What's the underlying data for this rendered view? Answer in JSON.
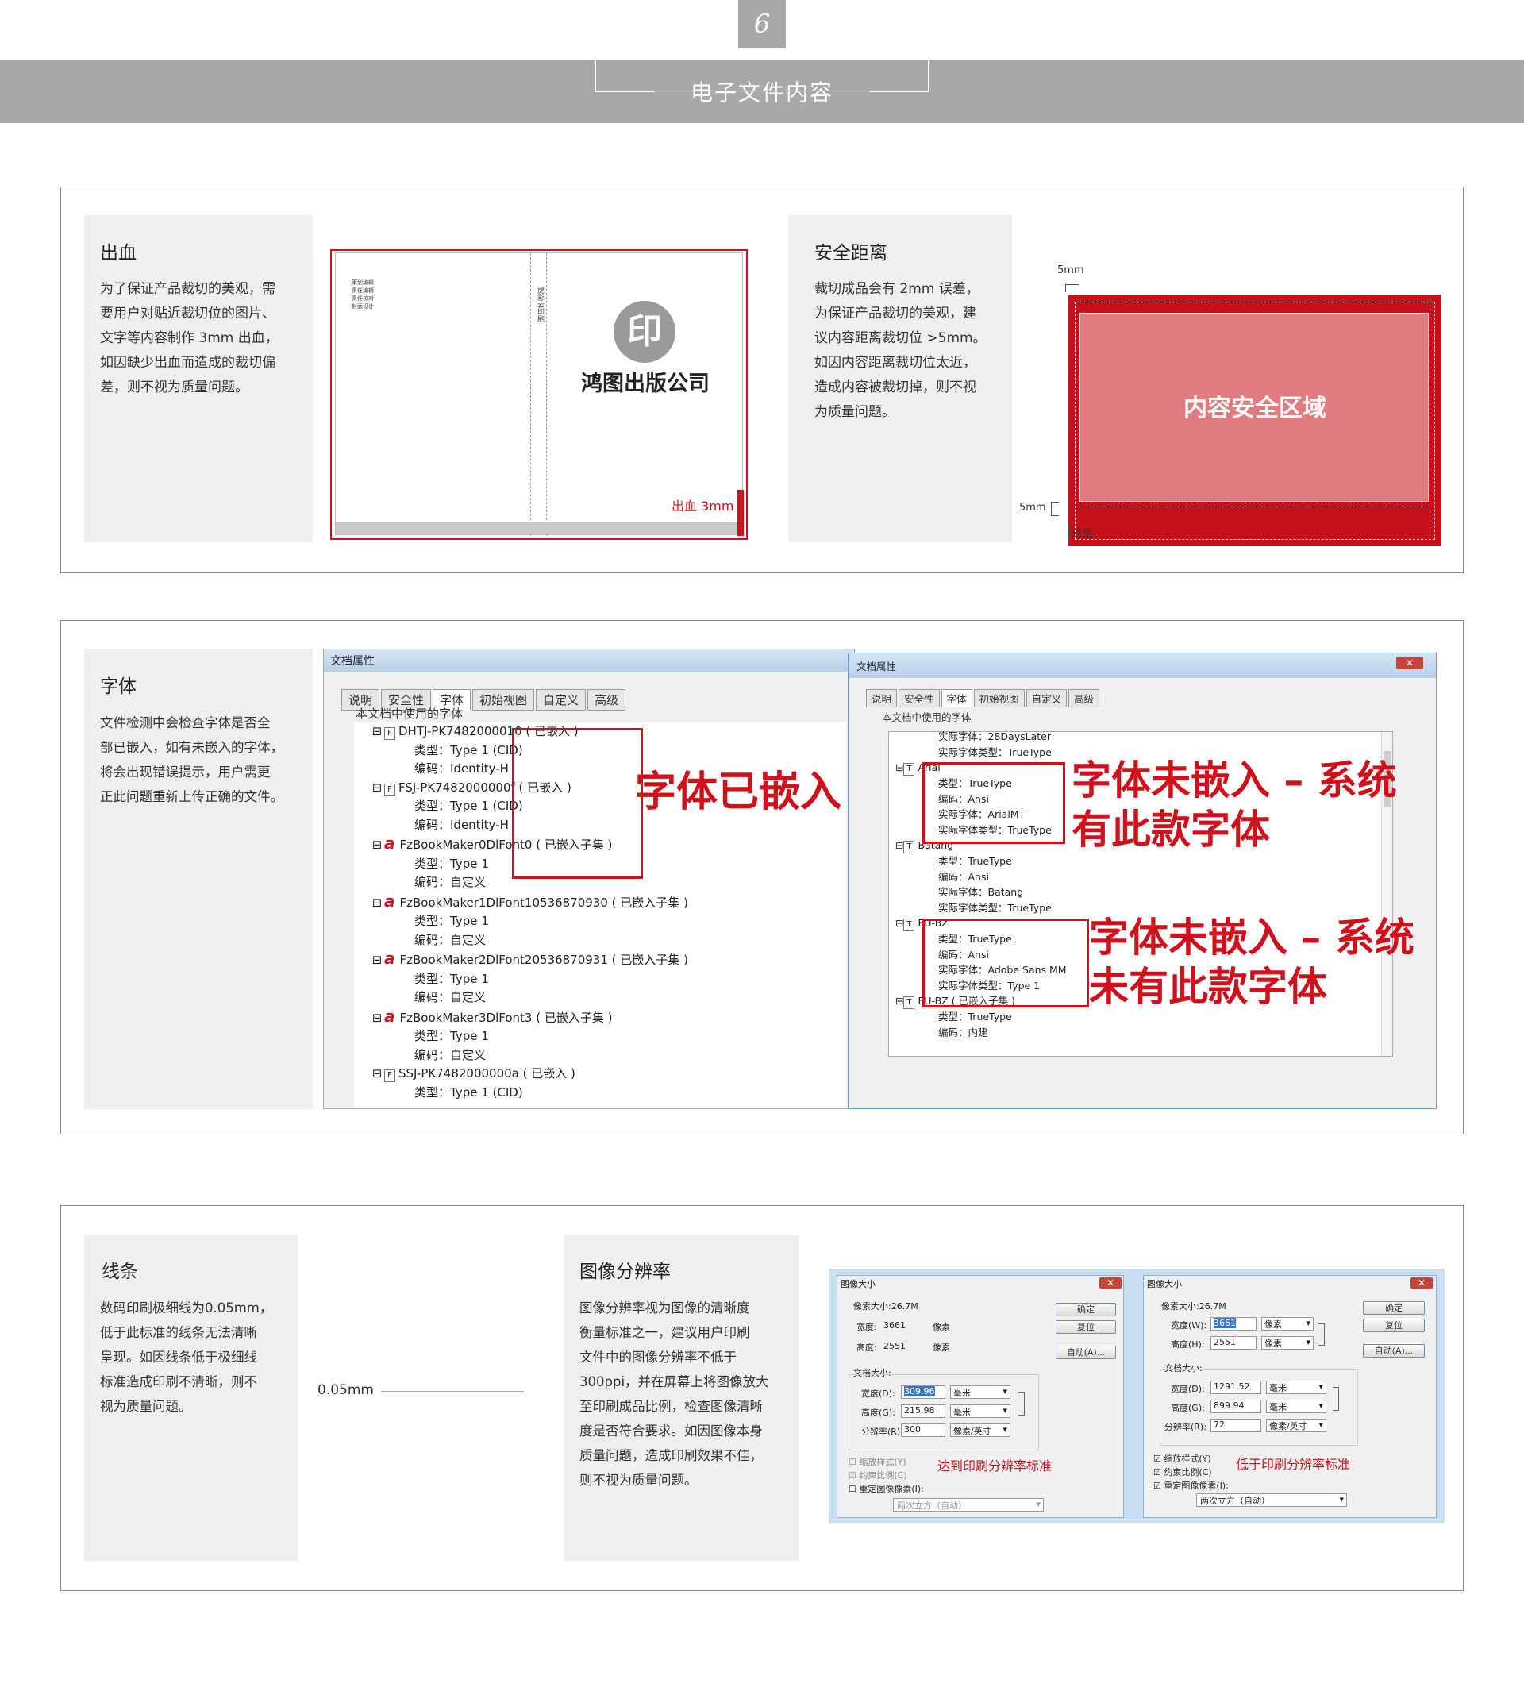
{
  "header": {
    "page_number": "6",
    "title": "电子文件内容"
  },
  "bleed": {
    "title": "出血",
    "text": [
      "为了保证产品裁切的美观，需",
      "要用户对贴近裁切位的图片、",
      "文字等内容制作 3mm 出血，",
      "如因缺少出血而造成的裁切偏",
      "差，则不视为质量问题。"
    ],
    "credits": [
      "策划编辑",
      "责任编辑",
      "责任校对",
      "封面设计"
    ],
    "spine": "虎彩云印刷",
    "seal": "印",
    "publisher": "鸿图出版公司",
    "label": "出血 3mm"
  },
  "safety": {
    "title": "安全距离",
    "text": [
      "裁切成品会有 2mm 误差，",
      "为保证产品裁切的美观，建",
      "议内容距离裁切位 >5mm。",
      "如因内容距离裁切位太近，",
      "造成内容被裁切掉，则不视",
      "为质量问题。"
    ],
    "top_label": "5mm",
    "side_label": "5mm",
    "product_label": "成品",
    "zone_label": "内容安全区域"
  },
  "fonts": {
    "title": "字体",
    "text": [
      "文件检测中会检查字体是否全",
      "部已嵌入，如有未嵌入的字体，",
      "将会出现错误提示，用户需更",
      "正此问题重新上传正确的文件。"
    ],
    "left_dialog": {
      "title": "文档属性",
      "tabs": [
        "说明",
        "安全性",
        "字体",
        "初始视图",
        "自定义",
        "高级"
      ],
      "group": "本文档中使用的字体",
      "rows": [
        {
          "icon": "F",
          "text": "DHTJ-PK7482000010 ( 已嵌入 )"
        },
        {
          "icon": "",
          "text": "类型：Type 1 (CID)"
        },
        {
          "icon": "",
          "text": "编码：Identity-H"
        },
        {
          "icon": "F",
          "text": "FSJ-PK7482000000f ( 已嵌入 )"
        },
        {
          "icon": "",
          "text": "类型：Type 1 (CID)"
        },
        {
          "icon": "",
          "text": "编码：Identity-H"
        },
        {
          "icon": "a",
          "text": "FzBookMaker0DlFont0 ( 已嵌入子集 )"
        },
        {
          "icon": "",
          "text": "类型：Type 1"
        },
        {
          "icon": "",
          "text": "编码：自定义"
        },
        {
          "icon": "a",
          "text": "FzBookMaker1DlFont10536870930 ( 已嵌入子集 )"
        },
        {
          "icon": "",
          "text": "类型：Type 1"
        },
        {
          "icon": "",
          "text": "编码：自定义"
        },
        {
          "icon": "a",
          "text": "FzBookMaker2DlFont20536870931 ( 已嵌入子集 )"
        },
        {
          "icon": "",
          "text": "类型：Type 1"
        },
        {
          "icon": "",
          "text": "编码：自定义"
        },
        {
          "icon": "a",
          "text": "FzBookMaker3DlFont3 ( 已嵌入子集 )"
        },
        {
          "icon": "",
          "text": "类型：Type 1"
        },
        {
          "icon": "",
          "text": "编码：自定义"
        },
        {
          "icon": "F",
          "text": "SSJ-PK7482000000a ( 已嵌入 )"
        },
        {
          "icon": "",
          "text": "类型：Type 1 (CID)"
        }
      ]
    },
    "right_dialog": {
      "title": "文档属性",
      "close": "✕",
      "tabs": [
        "说明",
        "安全性",
        "字体",
        "初始视图",
        "自定义",
        "高级"
      ],
      "group": "本文档中使用的字体",
      "rows": [
        {
          "icon": "",
          "text": "实际字体：28DaysLater"
        },
        {
          "icon": "",
          "text": "实际字体类型：TrueType"
        },
        {
          "icon": "T",
          "text": "Arial"
        },
        {
          "icon": "",
          "text": "类型：TrueType"
        },
        {
          "icon": "",
          "text": "编码：Ansi"
        },
        {
          "icon": "",
          "text": "实际字体：ArialMT"
        },
        {
          "icon": "",
          "text": "实际字体类型：TrueType"
        },
        {
          "icon": "T",
          "text": "Batang"
        },
        {
          "icon": "",
          "text": "类型：TrueType"
        },
        {
          "icon": "",
          "text": "编码：Ansi"
        },
        {
          "icon": "",
          "text": "实际字体：Batang"
        },
        {
          "icon": "",
          "text": "实际字体类型：TrueType"
        },
        {
          "icon": "T",
          "text": "EU-BZ"
        },
        {
          "icon": "",
          "text": "类型：TrueType"
        },
        {
          "icon": "",
          "text": "编码：Ansi"
        },
        {
          "icon": "",
          "text": "实际字体：Adobe Sans MM"
        },
        {
          "icon": "",
          "text": "实际字体类型：Type 1"
        },
        {
          "icon": "T",
          "text": "EU-BZ ( 已嵌入子集 )"
        },
        {
          "icon": "",
          "text": "类型：TrueType"
        },
        {
          "icon": "",
          "text": "编码：内建"
        }
      ]
    },
    "callout_embedded": "字体已嵌入",
    "callout_has": [
      "字体未嵌入 – 系统",
      "有此款字体"
    ],
    "callout_missing": [
      "字体未嵌入 – 系统",
      "未有此款字体"
    ]
  },
  "lines": {
    "title": "线条",
    "text": [
      "数码印刷极细线为0.05mm，",
      "低于此标准的线条无法清晰",
      "呈现。如因线条低于极细线",
      "标准造成印刷不清晰，则不",
      "视为质量问题。"
    ],
    "sample_label": "0.05mm"
  },
  "resolution": {
    "title": "图像分辨率",
    "text": [
      "图像分辨率视为图像的清晰度",
      "衡量标准之一，建议用户印刷",
      "文件中的图像分辨率不低于",
      "300ppi，并在屏幕上将图像放大",
      "至印刷成品比例，检查图像清晰",
      "度是否符合要求。如因图像本身",
      "质量问题，造成印刷效果不佳，",
      "则不视为质量问题。"
    ],
    "left_dialog": {
      "title": "图像大小",
      "close": "✕",
      "pixel_size": "像素大小:26.7M",
      "width_label": "宽度:",
      "width_value": "3661",
      "width_unit": "像素",
      "height_label": "高度:",
      "height_value": "2551",
      "height_unit": "像素",
      "doc_size": "文档大小:",
      "dw_label": "宽度(D):",
      "dw_value": "309.96",
      "dw_unit": "毫米",
      "dh_label": "高度(G):",
      "dh_value": "215.98",
      "dh_unit": "毫米",
      "res_label": "分辨率(R):",
      "res_value": "300",
      "res_unit": "像素/英寸",
      "checks": [
        "缩放样式(Y)",
        "约束比例(C)",
        "重定图像像素(I):"
      ],
      "resample": "两次立方（自动）",
      "buttons": [
        "确定",
        "复位",
        "自动(A)..."
      ],
      "note": "达到印刷分辨率标准"
    },
    "right_dialog": {
      "title": "图像大小",
      "close": "✕",
      "pixel_size": "像素大小:26.7M",
      "width_label": "宽度(W):",
      "width_value": "3661",
      "width_unit": "像素",
      "height_label": "高度(H):",
      "height_value": "2551",
      "height_unit": "像素",
      "doc_size": "文档大小:",
      "dw_label": "宽度(D):",
      "dw_value": "1291.52",
      "dw_unit": "毫米",
      "dh_label": "高度(G):",
      "dh_value": "899.94",
      "dh_unit": "毫米",
      "res_label": "分辨率(R):",
      "res_value": "72",
      "res_unit": "像素/英寸",
      "checks": [
        "缩放样式(Y)",
        "约束比例(C)",
        "重定图像像素(I):"
      ],
      "resample": "两次立方（自动）",
      "buttons": [
        "确定",
        "复位",
        "自动(A)..."
      ],
      "note": "低于印刷分辨率标准"
    }
  }
}
